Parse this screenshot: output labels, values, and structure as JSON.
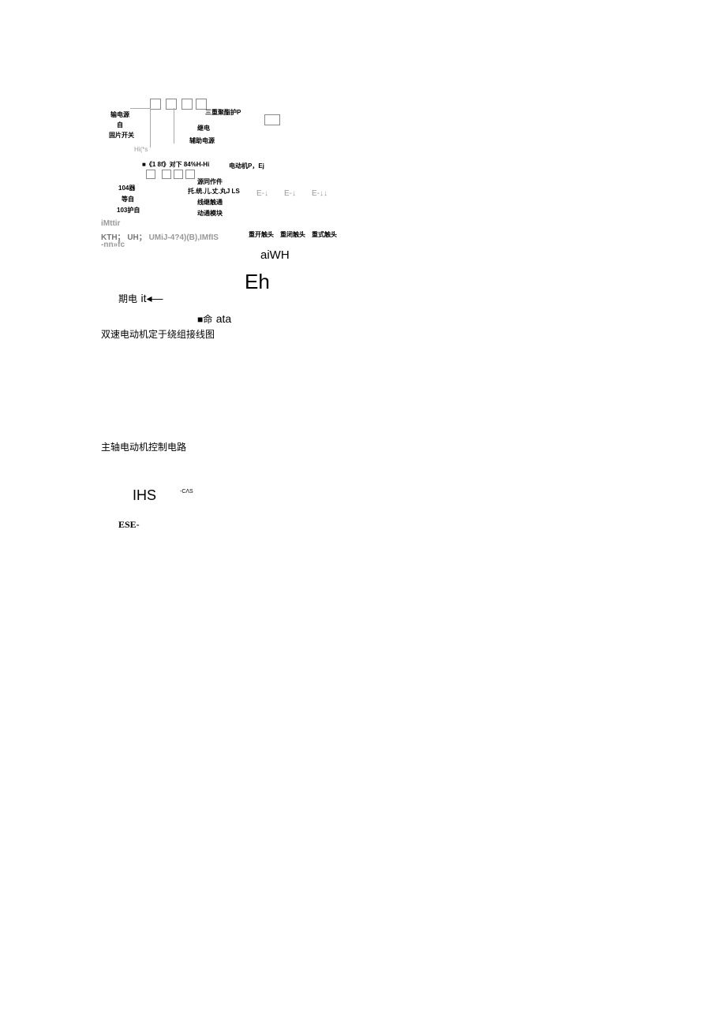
{
  "diagram": {
    "upper_left_labels": {
      "l1": "输电源",
      "l2": "自",
      "l3": "固片开关"
    },
    "upper_right_labels": {
      "l1": "三重聚酯护P"
    },
    "upper_mid_labels": {
      "l1": "继电",
      "l2": "辅助电源"
    },
    "small_gray": "Hi(*s",
    "mid_banner": "■《1 8f》对下 84%H-Hi",
    "mid_right": "电动机P，Ej",
    "lower_left_labels": {
      "l1": "104器",
      "l2": "等自",
      "l3": "103护自"
    },
    "lower_mid_labels": {
      "l1": "源同作件",
      "l2": "托.统.儿.丈.丸J LS",
      "l3": "线继触通",
      "l4": "动通模块"
    }
  },
  "labels": {
    "iMttir": "iMttir",
    "kth_line": "KTH；  UH；",
    "kth_gray": "UMiJ-4?4)(B),IMfIS",
    "nnfc": "-nn»fc",
    "cluster1": "重开触头",
    "cluster2": "重闭触头",
    "cluster3": "重式触头"
  },
  "text": {
    "aiwh": "aiWH",
    "eh": "Eh",
    "qidian_it": "期电",
    "it_arrow": "it◂—",
    "ming_ata_prefix": "■命",
    "ming_ata": "ata",
    "caption1": "双速电动机定于绕组接线图",
    "caption2": "主轴电动机控制电路",
    "ihs": "IHS",
    "cas": "-CΛS",
    "ese": "ESE-"
  }
}
